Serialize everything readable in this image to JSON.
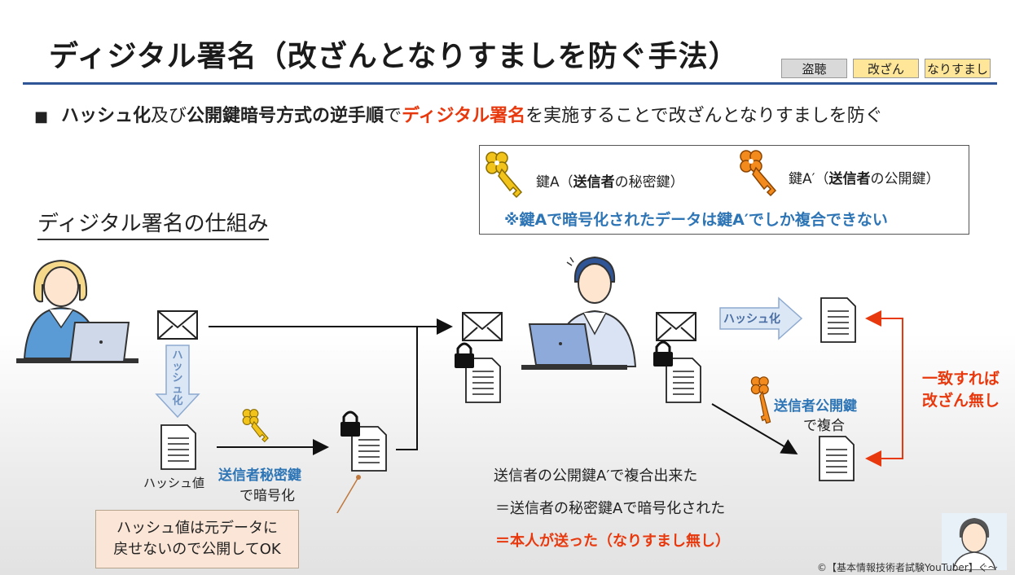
{
  "title": "ディジタル署名（改ざんとなりすましを防ぐ手法）",
  "tags": [
    "盗聴",
    "改ざん",
    "なりすまし"
  ],
  "bullet": {
    "marker": "■",
    "p1_bold": "ハッシュ化",
    "p2": "及び",
    "p3_bold": "公開鍵暗号方式の逆手順",
    "p4": "で",
    "p5_red": "ディジタル署名",
    "p6": "を実施することで改ざんとなりすましを防ぐ"
  },
  "legend": {
    "key_a_prefix": "鍵A（",
    "key_a_bold": "送信者",
    "key_a_suffix": "の秘密鍵）",
    "key_b_prefix": "鍵A′（",
    "key_b_bold": "送信者",
    "key_b_suffix": "の公開鍵）",
    "note": "※鍵Aで暗号化されたデータは鍵A′でしか複合できない"
  },
  "section_heading": "ディジタル署名の仕組み",
  "diagram": {
    "hash_arrow_vertical": "ハッシュ化",
    "hash_value_label": "ハッシュ値",
    "sign_label_bold": "送信者秘密鍵",
    "sign_label_rest": "で暗号化",
    "hash_arrow_right": "ハッシュ化",
    "verify_label_bold": "送信者公開鍵",
    "verify_label_rest": "で複合",
    "match_line1": "一致すれば",
    "match_line2": "改ざん無し"
  },
  "note_box": {
    "line1": "ハッシュ値は元データに",
    "line2": "戻せないので公開してOK"
  },
  "statements": {
    "line1": "送信者の公開鍵A′で複合出来た",
    "line2": "＝送信者の秘密鍵Aで暗号化された",
    "line3": "＝本人が送った（なりすまし無し）"
  },
  "credit": "©【基本情報技術者試験YouTuber】ぐ～",
  "colors": {
    "title_rule": "#2f5597",
    "accent_red": "#e8380d",
    "accent_blue": "#2e75b6",
    "gold_key": "#f2c31a",
    "orange_key": "#f28a1e",
    "hash_arrow": "#dbe7f5"
  },
  "icons": [
    "envelope-icon",
    "document-icon",
    "padlock-icon",
    "gold-key-icon",
    "orange-key-icon",
    "person-icon",
    "laptop-icon"
  ]
}
